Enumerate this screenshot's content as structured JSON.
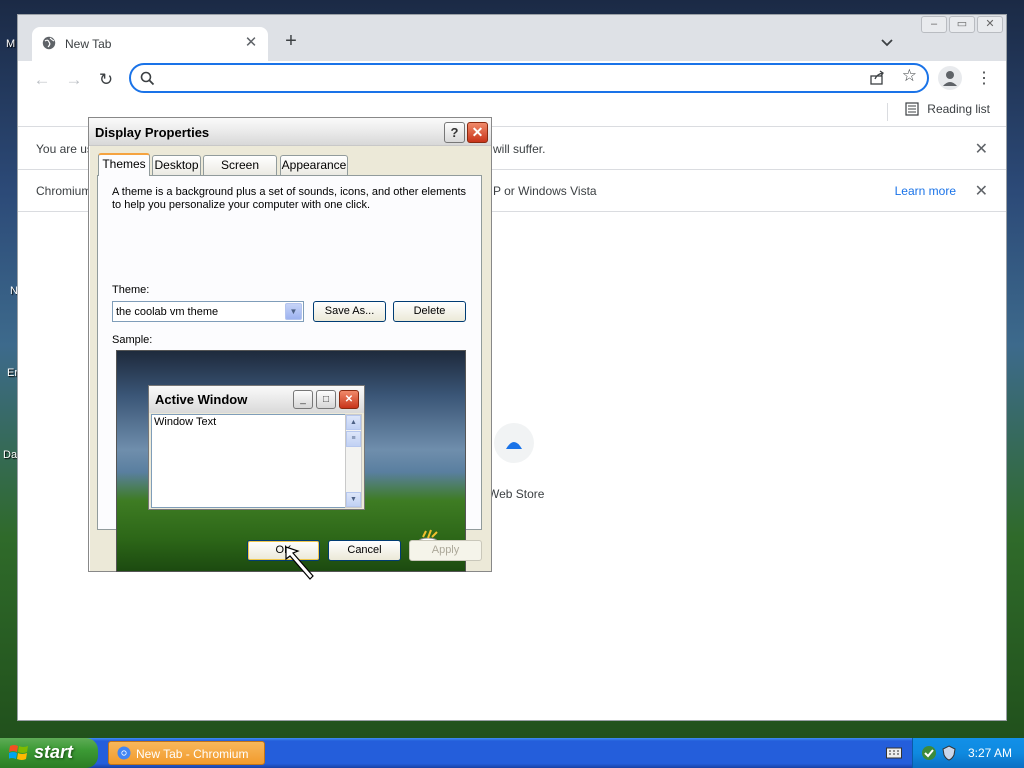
{
  "desktop": {
    "fragments": [
      "M",
      "N",
      "Er",
      "Da"
    ]
  },
  "browser": {
    "tab_title": "New Tab",
    "new_tab_symbol": "+",
    "omnibox_value": "",
    "reading_list_label": "Reading list",
    "infobar1_text_start": "You are us",
    "infobar1_text_end": "will suffer.",
    "infobar2_text_start": "Chromium",
    "infobar2_text_end": "P or Windows Vista",
    "learn_more": "Learn more",
    "shortcut_label": "Web Store"
  },
  "dialog": {
    "title": "Display Properties",
    "help": "?",
    "close": "✕",
    "tabs": [
      "Themes",
      "Desktop",
      "Screen Saver",
      "Appearance"
    ],
    "description": "A theme is a background plus a set of sounds, icons, and other elements to help you personalize your computer with one click.",
    "theme_label": "Theme:",
    "theme_value": "the coolab vm theme",
    "save_as": "Save As...",
    "delete": "Delete",
    "sample_label": "Sample:",
    "sample": {
      "window_title": "Active Window",
      "window_text": "Window Text"
    },
    "ok": "OK",
    "cancel": "Cancel",
    "apply": "Apply"
  },
  "taskbar": {
    "start_label": "start",
    "task_item": "New Tab - Chromium",
    "clock": "3:27 AM"
  },
  "colors": {
    "accent": "#1a73e8",
    "xp_taskbar": "#245edb",
    "xp_start": "#3c9a35"
  }
}
